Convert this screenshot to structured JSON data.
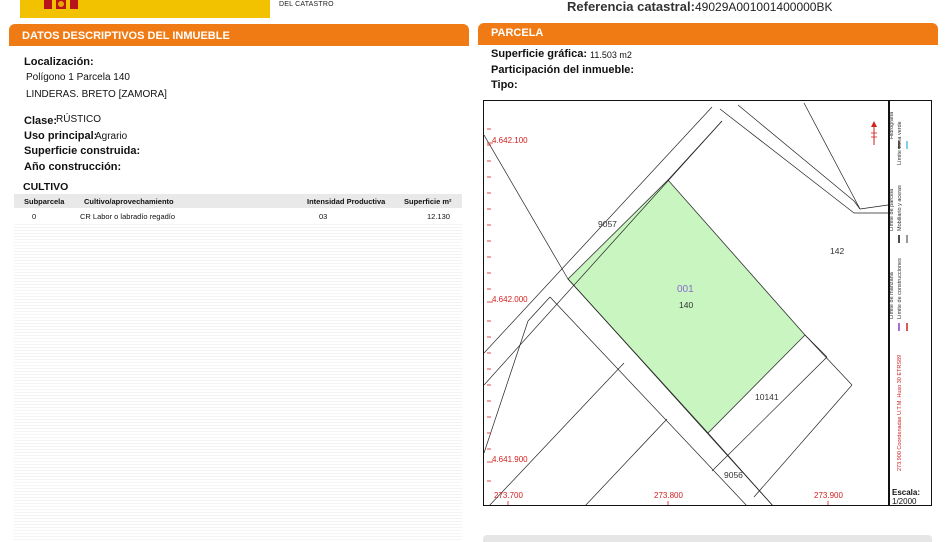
{
  "header": {
    "catastro_subtitle": "DEL CATASTRO",
    "ref_label": "Referencia catastral:",
    "ref_value": "49029A001001400000BK"
  },
  "left_panel": {
    "title": "DATOS DESCRIPTIVOS DEL INMUEBLE",
    "localizacion_label": "Localización:",
    "localizacion_line1": "Polígono 1 Parcela 140",
    "localizacion_line2": "LINDERAS. BRETO [ZAMORA]",
    "clase_label": "Clase:",
    "clase_value": "RÚSTICO",
    "uso_label": "Uso principal:",
    "uso_value": "Agrario",
    "sup_construida_label": "Superficie construida:",
    "ano_label": "Año construcción:",
    "cultivo_title": "CULTIVO",
    "cultivo_headers": [
      "Subparcela",
      "Cultivo/aprovechamiento",
      "Intensidad Productiva",
      "Superficie m²"
    ],
    "cultivo_rows": [
      [
        "0",
        "CR Labor o labradío regadío",
        "03",
        "12.130"
      ]
    ]
  },
  "right_panel": {
    "title": "PARCELA",
    "sup_grafica_label": "Superficie gráfica:",
    "sup_grafica_value": "11.503 m2",
    "participacion_label": "Participación del inmueble:",
    "tipo_label": "Tipo:"
  },
  "map": {
    "y_coords": [
      "4.642.100",
      "4.642.000",
      "4.641.900"
    ],
    "x_coords": [
      "273.700",
      "273.800",
      "273.900"
    ],
    "parcel_labels": [
      "9057",
      "142",
      "001",
      "140",
      "10141",
      "9056"
    ],
    "legend": {
      "hidrografia": "Hidrografía",
      "zona_verde": "Límite zona verde",
      "parcela": "Límite de parcela",
      "mobiliario": "Mobiliario y aceras",
      "manzana": "Límite de manzana",
      "construcciones": "Límite de construcciones",
      "coordenadas": "273.900 Coordenadas U.T.M. Huso 30 ETRS89"
    },
    "escala_label": "Escala:",
    "escala_value": "1/2000",
    "colors": {
      "parcel_fill": "#c8f5c0",
      "coord_red": "#d02020",
      "accent_orange": "#f07b14"
    }
  }
}
